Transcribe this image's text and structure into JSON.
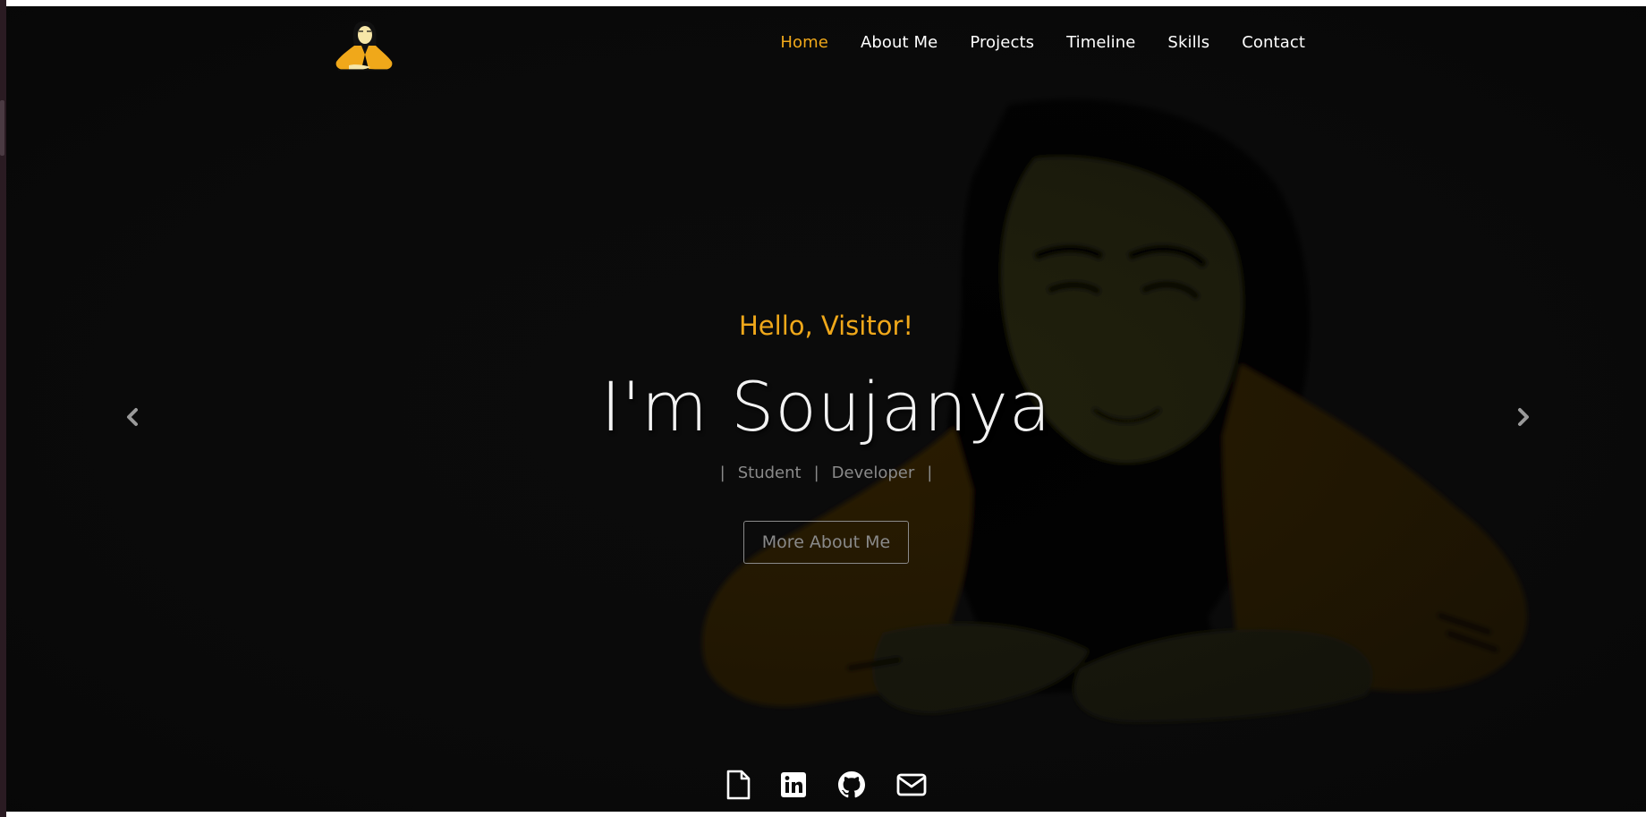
{
  "navbar": {
    "logo_alt": "Soujanya logo",
    "links": [
      {
        "label": "Home",
        "active": true
      },
      {
        "label": "About Me",
        "active": false
      },
      {
        "label": "Projects",
        "active": false
      },
      {
        "label": "Timeline",
        "active": false
      },
      {
        "label": "Skills",
        "active": false
      },
      {
        "label": "Contact",
        "active": false
      }
    ]
  },
  "hero": {
    "greeting": "Hello, Visitor!",
    "name": "I'm Soujanya",
    "roles": [
      "Student",
      "Developer"
    ],
    "cta_label": "More About Me"
  },
  "carousel": {
    "prev_icon": "chevron-left-icon",
    "next_icon": "chevron-right-icon"
  },
  "socials": [
    {
      "icon": "file-icon",
      "label": "Resume"
    },
    {
      "icon": "linkedin-icon",
      "label": "LinkedIn"
    },
    {
      "icon": "github-icon",
      "label": "GitHub"
    },
    {
      "icon": "mail-icon",
      "label": "Email"
    }
  ],
  "colors": {
    "accent": "#f0a81a",
    "background": "#0b0b0b",
    "text": "#ffffff",
    "muted": "#8a8a8a"
  }
}
